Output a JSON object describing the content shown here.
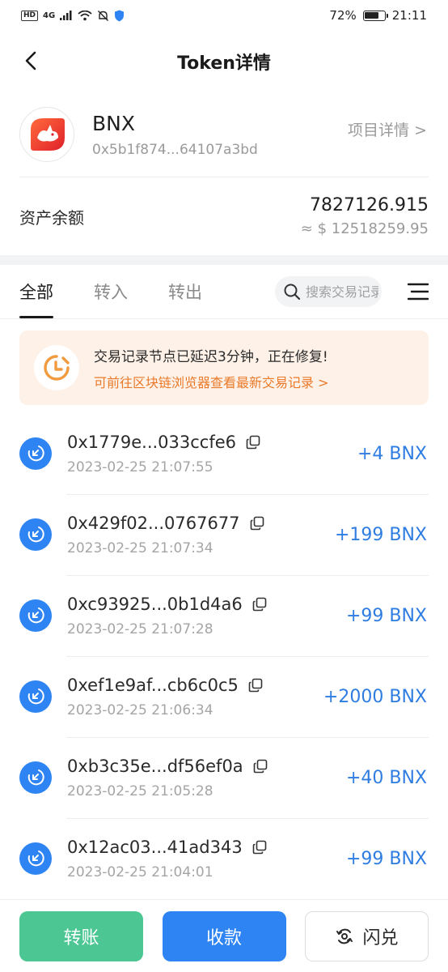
{
  "status_bar": {
    "hd": "HD",
    "network": "4G",
    "battery": "72%",
    "battery_level": 0.72,
    "time": "21:11"
  },
  "nav": {
    "title": "Token详情"
  },
  "token": {
    "name": "BNX",
    "address": "0x5b1f874...64107a3bd",
    "project_link": "项目详情 >"
  },
  "balance": {
    "label": "资产余额",
    "amount": "7827126.915",
    "usd": "≈ $ 12518259.95"
  },
  "tabs": [
    {
      "label": "全部",
      "active": true
    },
    {
      "label": "转入",
      "active": false
    },
    {
      "label": "转出",
      "active": false
    }
  ],
  "search": {
    "placeholder": "搜索交易记录"
  },
  "notice": {
    "title": "交易记录节点已延迟3分钟，正在修复!",
    "link": "可前往区块链浏览器查看最新交易记录 >"
  },
  "transactions": [
    {
      "hash": "0x1779e...033ccfe6",
      "time": "2023-02-25 21:07:55",
      "amount": "+4 BNX"
    },
    {
      "hash": "0x429f02...0767677",
      "time": "2023-02-25 21:07:34",
      "amount": "+199 BNX"
    },
    {
      "hash": "0xc93925...0b1d4a6",
      "time": "2023-02-25 21:07:28",
      "amount": "+99 BNX"
    },
    {
      "hash": "0xef1e9af...cb6c0c5",
      "time": "2023-02-25 21:06:34",
      "amount": "+2000 BNX"
    },
    {
      "hash": "0xb3c35e...df56ef0a",
      "time": "2023-02-25 21:05:28",
      "amount": "+40 BNX"
    },
    {
      "hash": "0x12ac03...41ad343",
      "time": "2023-02-25 21:04:01",
      "amount": "+99 BNX"
    }
  ],
  "bottom_bar": {
    "transfer": "转账",
    "receive": "收款",
    "swap": "闪兑"
  },
  "colors": {
    "accent_blue": "#2f84f4",
    "transfer_green": "#4cc793",
    "notice_orange": "#ea7a2a",
    "amount_blue": "#2f7de1"
  },
  "icons": {
    "back": "chevron-left-icon",
    "token_logo": "bnx-logo-icon",
    "notice": "clock-icon",
    "search": "search-icon",
    "menu": "menu-icon",
    "tx": "incoming-transfer-icon",
    "copy": "copy-icon",
    "swap": "swap-icon"
  }
}
